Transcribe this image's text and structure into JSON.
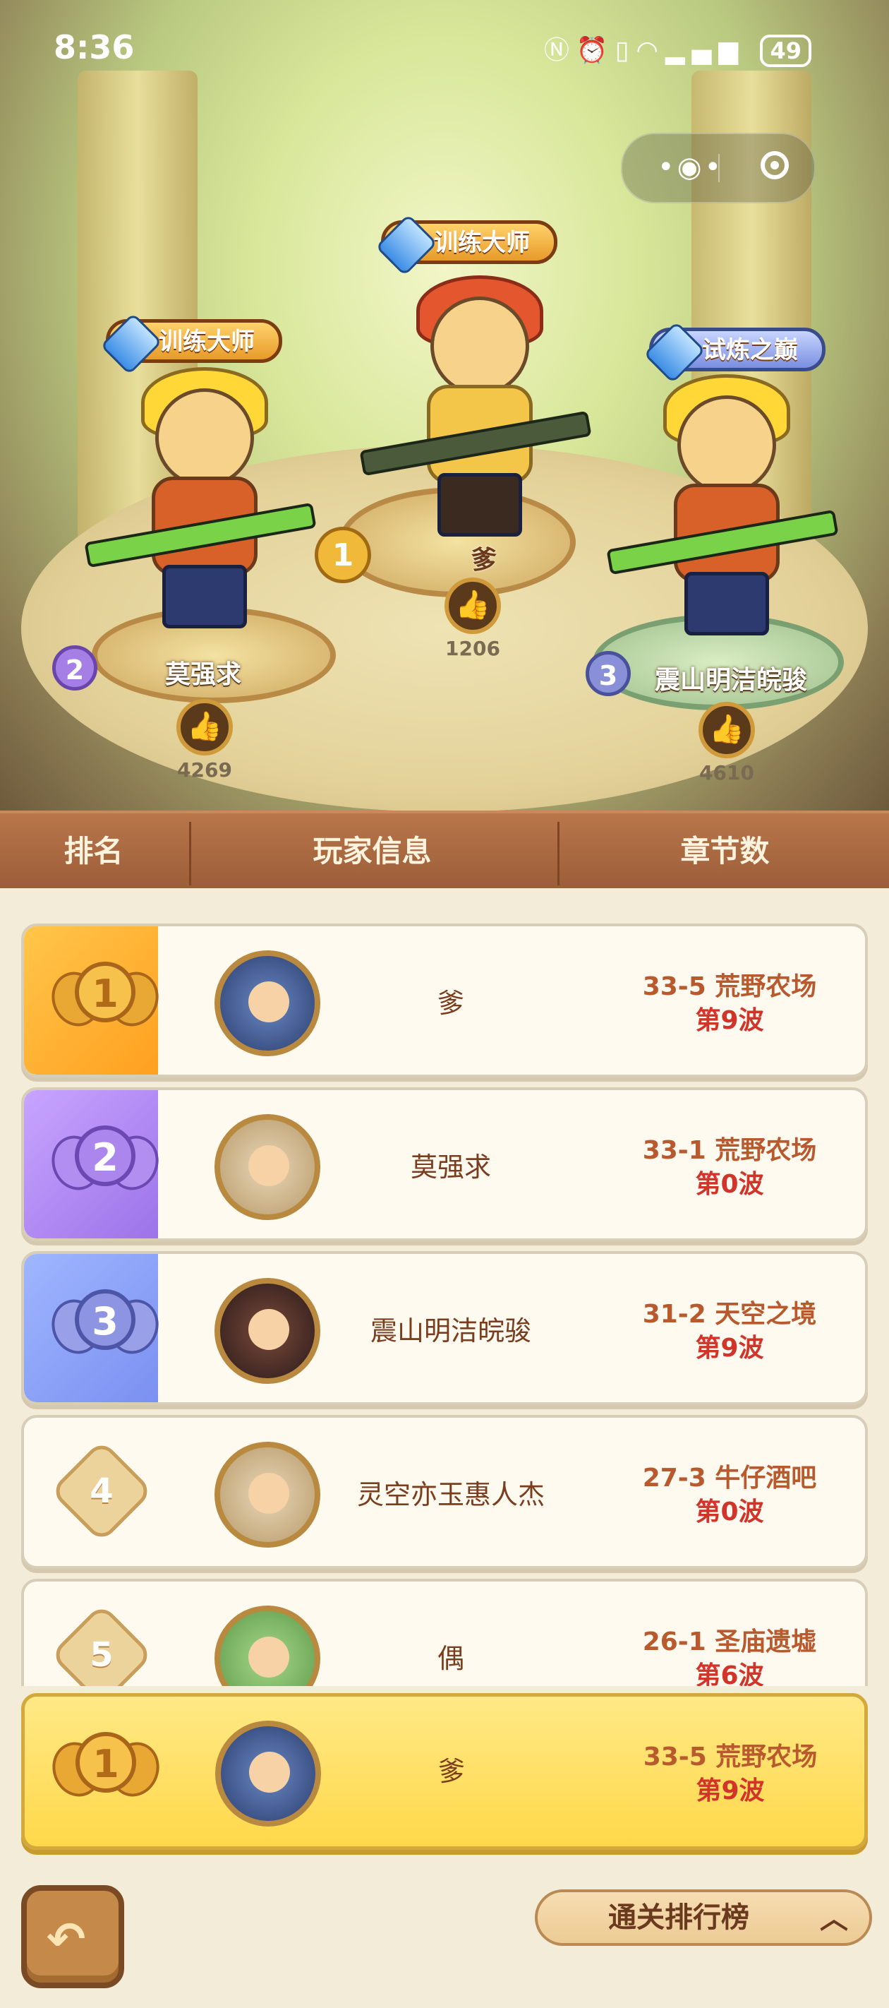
{
  "status_bar": {
    "time": "8:36",
    "icons": [
      "nfc-icon",
      "alarm-icon",
      "vibrate-icon",
      "wifi-icon",
      "4g-signal-icon"
    ],
    "battery": "49"
  },
  "podium": {
    "first": {
      "rank": "1",
      "title": "训练大师",
      "name": "爹",
      "likes": "1206"
    },
    "second": {
      "rank": "2",
      "title": "训练大师",
      "name": "莫强求",
      "likes": "4269"
    },
    "third": {
      "rank": "3",
      "title": "试炼之巅",
      "name": "震山明洁皖骏",
      "likes": "4610"
    }
  },
  "table_header": {
    "rank": "排名",
    "player": "玩家信息",
    "chapter": "章节数"
  },
  "rows": [
    {
      "rank": "1",
      "name": "爹",
      "chapter": "33-5 荒野农场",
      "wave": "第9波"
    },
    {
      "rank": "2",
      "name": "莫强求",
      "chapter": "33-1 荒野农场",
      "wave": "第0波"
    },
    {
      "rank": "3",
      "name": "震山明洁皖骏",
      "chapter": "31-2 天空之境",
      "wave": "第9波"
    },
    {
      "rank": "4",
      "name": "灵空亦玉惠人杰",
      "chapter": "27-3 牛仔酒吧",
      "wave": "第0波"
    },
    {
      "rank": "5",
      "name": "偶",
      "chapter": "26-1 圣庙遗墟",
      "wave": "第6波"
    }
  ],
  "my_rank": {
    "rank": "1",
    "name": "爹",
    "chapter": "33-5 荒野农场",
    "wave": "第9波"
  },
  "footer": {
    "leaderboard_label": "通关排行榜"
  },
  "colors": {
    "header_brown": "#9a5c38",
    "gold": "#ffc64a",
    "purple": "#9b72e8",
    "blue": "#7a8ff0",
    "wave_red": "#d2342a"
  }
}
